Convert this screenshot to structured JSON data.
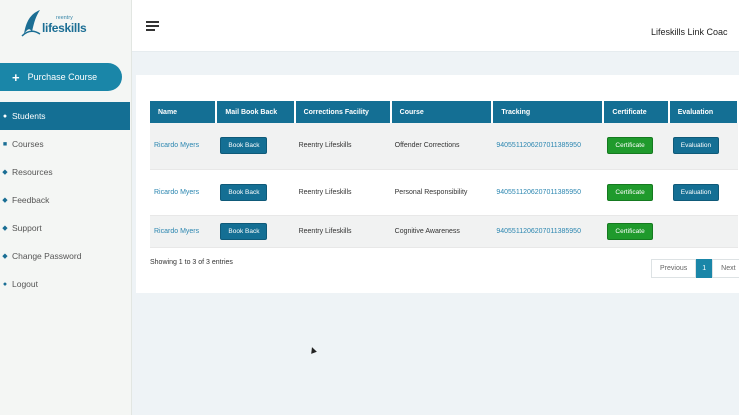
{
  "sidebar": {
    "logo": {
      "small_text": "reentry",
      "big_text": "lifeskills"
    },
    "purchase_label": "Purchase Course",
    "items": [
      {
        "label": "Students",
        "icon": "user-icon",
        "active": true
      },
      {
        "label": "Courses",
        "icon": "graduation-cap-icon"
      },
      {
        "label": "Resources",
        "icon": "resources-icon"
      },
      {
        "label": "Feedback",
        "icon": "feedback-icon"
      },
      {
        "label": "Support",
        "icon": "support-icon"
      },
      {
        "label": "Change Password",
        "icon": "key-icon"
      },
      {
        "label": "Logout",
        "icon": "logout-icon"
      }
    ]
  },
  "header": {
    "title": "Lifeskills Link Coac"
  },
  "table": {
    "columns": [
      "Name",
      "Mail Book Back",
      "Corrections Facility",
      "Course",
      "Tracking",
      "Certificate",
      "Evaluation"
    ],
    "rows": [
      {
        "name": "Ricardo Myers",
        "mail_btn": "Book Back",
        "facility": "Reentry Lifeskills",
        "course": "Offender Corrections",
        "tracking": "9405511206207011385950",
        "certificate_btn": "Certificate",
        "evaluation_btn": "Evaluation"
      },
      {
        "name": "Ricardo Myers",
        "mail_btn": "Book Back",
        "facility": "Reentry Lifeskills",
        "course": "Personal Responsibility",
        "tracking": "9405511206207011385950",
        "certificate_btn": "Certificate",
        "evaluation_btn": "Evaluation"
      },
      {
        "name": "Ricardo Myers",
        "mail_btn": "Book Back",
        "facility": "Reentry Lifeskills",
        "course": "Cognitive Awareness",
        "tracking": "9405511206207011385950",
        "certificate_btn": "Certificate",
        "evaluation_btn": ""
      }
    ]
  },
  "footer": {
    "showing": "Showing 1 to 3 of 3 entries",
    "previous": "Previous",
    "page": "1",
    "next": "Next"
  },
  "colors": {
    "primary": "#146f94",
    "accent": "#1a86a8",
    "success": "#1f9a2c"
  }
}
